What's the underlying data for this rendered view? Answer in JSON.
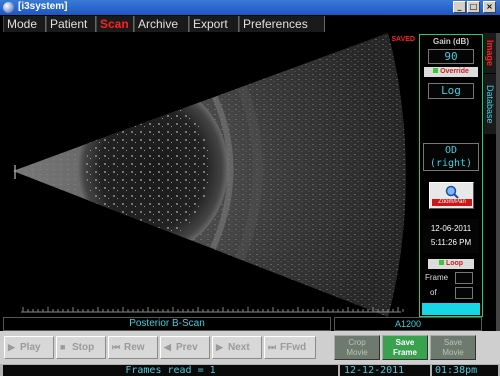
{
  "window": {
    "title": "[i3system]"
  },
  "window_buttons": {
    "minimize": "_",
    "maximize": "□",
    "close": "×"
  },
  "menu": {
    "tabs": [
      {
        "label": "Mode"
      },
      {
        "label": "Patient"
      },
      {
        "label": "Scan"
      },
      {
        "label": "Archive"
      },
      {
        "label": "Export"
      },
      {
        "label": "Preferences"
      }
    ],
    "active": "Scan"
  },
  "scan": {
    "status": "SAVED",
    "scan_label": "Posterior B-Scan",
    "probe_code": "A1200"
  },
  "right_panel": {
    "gain_title": "Gain (dB)",
    "gain_value": "90",
    "override_label": "Override",
    "mode_value": "Log",
    "eye_line1": "OD",
    "eye_line2": "(right)",
    "zoom_label": "Zoom/Pan",
    "date": "12-06-2011",
    "time": "5:11:26 PM",
    "loop_label": "Loop",
    "frame_label": "Frame",
    "of_label": "of"
  },
  "side_tabs": {
    "image": "Image",
    "database": "Database"
  },
  "playback": {
    "play": "Play",
    "stop": "Stop",
    "rew": "Rew",
    "prev": "Prev",
    "next": "Next",
    "ffwd": "FFwd"
  },
  "save_buttons": {
    "crop_line1": "Crop",
    "crop_line2": "Movie",
    "frame_line1": "Save",
    "frame_line2": "Frame",
    "movie_line1": "Save",
    "movie_line2": "Movie"
  },
  "status": {
    "frames": "Frames read = 1",
    "date": "12-12-2011",
    "time": "01:38pm"
  },
  "colors": {
    "accent_red": "#ff2020",
    "accent_cyan": "#3fd0e0",
    "active_green": "#3aa24e"
  }
}
